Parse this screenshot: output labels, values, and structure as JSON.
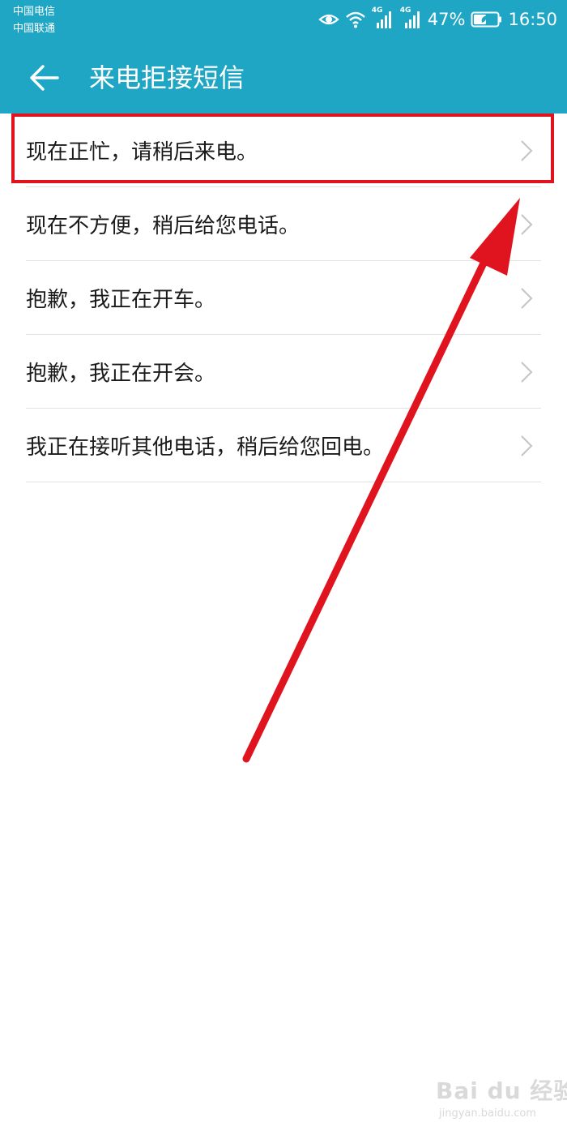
{
  "status_bar": {
    "carrier_1": "中国电信",
    "carrier_2": "中国联通",
    "network_label_1": "4G",
    "network_label_2": "4G",
    "battery_percent": "47%",
    "time": "16:50",
    "icons": [
      "eye-comfort-icon",
      "wifi-icon",
      "signal-icon",
      "signal-icon",
      "battery-icon"
    ]
  },
  "toolbar": {
    "back_icon": "back-arrow-icon",
    "title": "来电拒接短信",
    "background_color": "#1fa6c4"
  },
  "messages": [
    {
      "text": "现在正忙，请稍后来电。"
    },
    {
      "text": "现在不方便，稍后给您电话。"
    },
    {
      "text": "抱歉，我正在开车。"
    },
    {
      "text": "抱歉，我正在开会。"
    },
    {
      "text": "我正在接听其他电话，稍后给您回电。"
    }
  ],
  "annotation": {
    "highlight_color": "#e0141e",
    "highlighted_item_index": 0
  },
  "watermark": {
    "main": "Bai du 经验",
    "sub": "jingyan.baidu.com"
  }
}
